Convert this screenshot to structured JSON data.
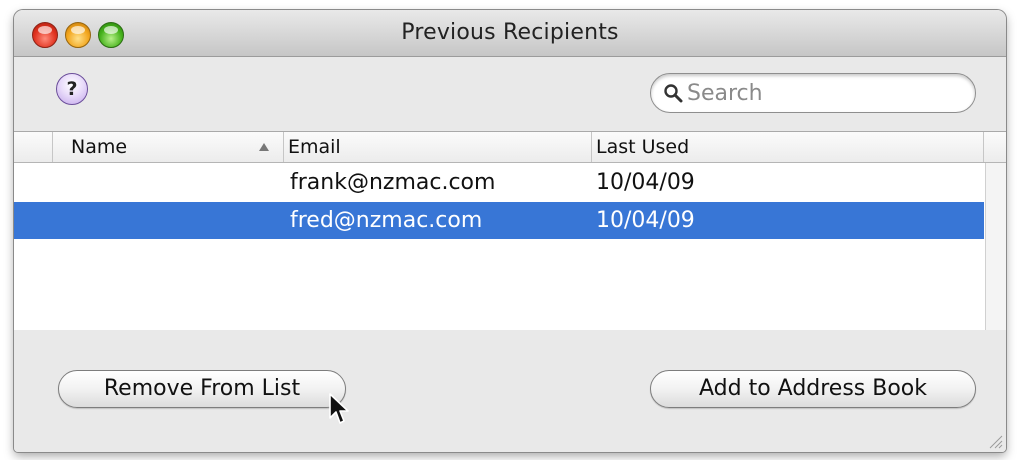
{
  "window": {
    "title": "Previous Recipients"
  },
  "toolbar": {
    "help_label": "?",
    "search_placeholder": "Search"
  },
  "table": {
    "columns": [
      "Name",
      "Email",
      "Last Used"
    ],
    "sort_column": "Name",
    "rows": [
      {
        "name": "",
        "email": "frank@nzmac.com",
        "last_used": "10/04/09",
        "selected": false
      },
      {
        "name": "",
        "email": "fred@nzmac.com",
        "last_used": "10/04/09",
        "selected": true
      }
    ]
  },
  "buttons": {
    "remove_label": "Remove From List",
    "add_label": "Add to Address Book"
  },
  "colors": {
    "selection": "#3876d6",
    "close": "#e0321f",
    "minimize": "#f2a51c",
    "zoom": "#46b21c",
    "help": "#c2a6ea"
  },
  "icons": [
    "close-button",
    "minimize-button",
    "zoom-button",
    "help-icon",
    "search-icon",
    "sort-ascending-icon",
    "pointer-cursor-icon",
    "resize-grip-icon"
  ]
}
